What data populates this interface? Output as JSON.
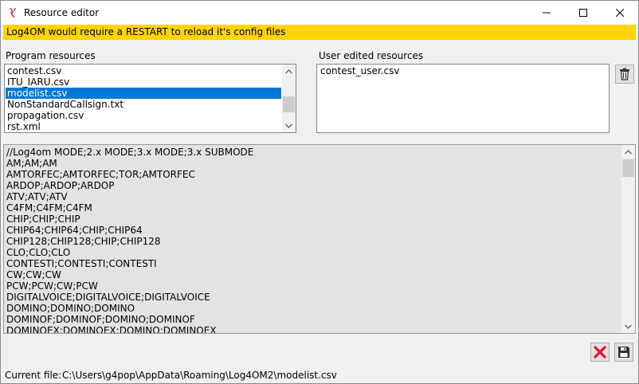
{
  "window": {
    "title": "Resource editor"
  },
  "banner": {
    "text": "Log4OM would require a RESTART to reload it's config files",
    "color": "#ffd400"
  },
  "program_resources": {
    "label": "Program resources",
    "items": [
      "contest.csv",
      "ITU_IARU.csv",
      "modelist.csv",
      "NonStandardCallsign.txt",
      "propagation.csv",
      "rst.xml"
    ],
    "selected": "modelist.csv"
  },
  "user_resources": {
    "label": "User edited resources",
    "items": [
      "contest_user.csv"
    ]
  },
  "editor": {
    "lines": [
      "//Log4om MODE;2.x MODE;3.x MODE;3.x SUBMODE",
      "AM;AM;AM",
      "AMTORFEC;AMTORFEC;TOR;AMTORFEC",
      "ARDOP;ARDOP;ARDOP",
      "ATV;ATV;ATV",
      "C4FM;C4FM;C4FM",
      "CHIP;CHIP;CHIP",
      "CHIP64;CHIP64;CHIP;CHIP64",
      "CHIP128;CHIP128;CHIP;CHIP128",
      "CLO;CLO;CLO",
      "CONTESTI;CONTESTI;CONTESTI",
      "CW;CW;CW",
      "PCW;PCW;CW;PCW",
      "DIGITALVOICE;DIGITALVOICE;DIGITALVOICE",
      "DOMINO;DOMINO;DOMINO",
      "DOMINOF;DOMINOF;DOMINO;DOMINOF",
      "DOMINOEX;DOMINOEX;DOMINO;DOMINOEX"
    ]
  },
  "status": {
    "label": "Current file:",
    "path": "C:\\Users\\g4pop\\AppData\\Roaming\\Log4OM2\\modelist.csv"
  },
  "icons": {
    "app": "app-icon",
    "delete": "trash-icon",
    "cancel": "red-x-icon",
    "save": "floppy-disk-icon"
  },
  "colors": {
    "selection": "#0078d7",
    "cancel_red": "#e81123"
  }
}
